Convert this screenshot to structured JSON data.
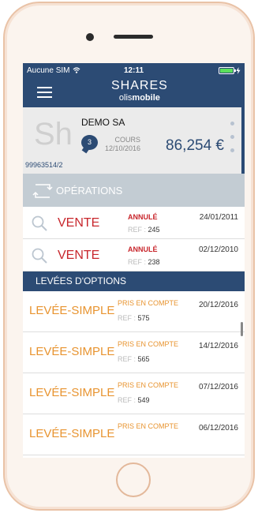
{
  "status_bar": {
    "carrier": "Aucune SIM",
    "time": "12:11"
  },
  "header": {
    "logo_line1": "SHARES",
    "logo_prefix": "olis",
    "logo_suffix": "mobile"
  },
  "company": {
    "avatar_initials": "Sh",
    "name": "DEMO SA",
    "account_id": "99963514/2",
    "badge_count": "3",
    "cours_label": "COURS",
    "cours_date": "12/10/2016",
    "price": "86,254 €"
  },
  "operations": {
    "title": "OPÉRATIONS",
    "items": [
      {
        "type": "VENTE",
        "status": "ANNULÉ",
        "ref_label": "REF :",
        "ref": "245",
        "date": "24/01/2011"
      },
      {
        "type": "VENTE",
        "status": "ANNULÉ",
        "ref_label": "REF :",
        "ref": "238",
        "date": "02/12/2010"
      }
    ]
  },
  "levees": {
    "title": "LEVÉES D'OPTIONS",
    "items": [
      {
        "type": "LEVÉE-SIMPLE",
        "status": "PRIS EN COMPTE",
        "ref_label": "REF :",
        "ref": "575",
        "date": "20/12/2016"
      },
      {
        "type": "LEVÉE-SIMPLE",
        "status": "PRIS EN COMPTE",
        "ref_label": "REF :",
        "ref": "565",
        "date": "14/12/2016"
      },
      {
        "type": "LEVÉE-SIMPLE",
        "status": "PRIS EN COMPTE",
        "ref_label": "REF :",
        "ref": "549",
        "date": "07/12/2016"
      },
      {
        "type": "LEVÉE-SIMPLE",
        "status": "PRIS EN COMPTE",
        "ref_label": "REF :",
        "ref": "",
        "date": "06/12/2016"
      }
    ]
  },
  "colors": {
    "primary": "#2c4b74",
    "cancel_red": "#c8262c",
    "pending_orange": "#e89430"
  }
}
